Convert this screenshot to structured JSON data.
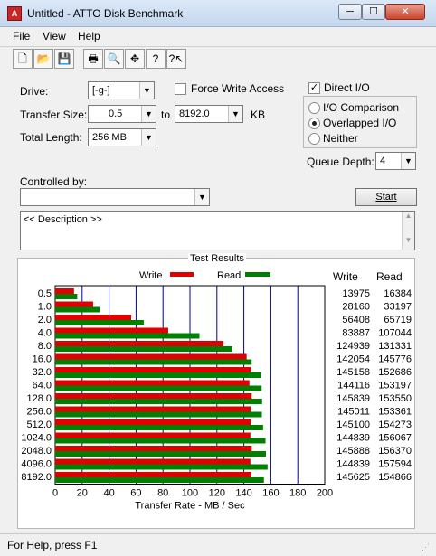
{
  "window": {
    "title": "Untitled - ATTO Disk Benchmark",
    "app_icon_label": "A",
    "controls": {
      "minimize": "─",
      "maximize": "☐",
      "close": "✕"
    }
  },
  "menu": [
    "File",
    "View",
    "Help"
  ],
  "toolbar": [
    "new-file-icon",
    "open-folder-icon",
    "save-icon",
    "print-icon",
    "print-preview-icon",
    "move-icon",
    "help-icon",
    "context-help-icon"
  ],
  "toolbar_glyphs": [
    "🗋",
    "📂",
    "💾",
    "🖶",
    "🔍",
    "✥",
    "?",
    "?↖"
  ],
  "form": {
    "drive_label": "Drive:",
    "drive_value": "[-g-]",
    "force_write_label": "Force Write Access",
    "direct_io_label": "Direct I/O",
    "direct_io_checked": true,
    "transfer_size_label": "Transfer Size:",
    "transfer_from": "0.5",
    "to_label": "to",
    "transfer_to": "8192.0",
    "kb_label": "KB",
    "total_length_label": "Total Length:",
    "total_length_value": "256 MB",
    "io_options": [
      "I/O Comparison",
      "Overlapped I/O",
      "Neither"
    ],
    "io_selected": 1,
    "queue_depth_label": "Queue Depth:",
    "queue_depth_value": "4",
    "controlled_by_label": "Controlled by:",
    "controlled_by_value": "",
    "start_label": "Start",
    "description": "<< Description >>"
  },
  "results": {
    "title": "Test Results",
    "write_header": "Write",
    "read_header": "Read",
    "write_color": "#e00000",
    "read_color": "#008000"
  },
  "chart_data": {
    "type": "bar",
    "orientation": "horizontal",
    "xlabel": "Transfer Rate - MB / Sec",
    "xlim": [
      0,
      200
    ],
    "xticks": [
      0,
      20,
      40,
      60,
      80,
      100,
      120,
      140,
      160,
      180,
      200
    ],
    "categories": [
      "0.5",
      "1.0",
      "2.0",
      "4.0",
      "8.0",
      "16.0",
      "32.0",
      "64.0",
      "128.0",
      "256.0",
      "512.0",
      "1024.0",
      "2048.0",
      "4096.0",
      "8192.0"
    ],
    "series": [
      {
        "name": "Write",
        "values": [
          13.975,
          28.16,
          56.408,
          83.887,
          124.939,
          142.054,
          145.158,
          144.116,
          145.839,
          145.011,
          145.1,
          144.839,
          145.888,
          144.839,
          145.625
        ]
      },
      {
        "name": "Read",
        "values": [
          16.384,
          33.197,
          65.719,
          107.044,
          131.331,
          145.776,
          152.686,
          153.197,
          153.55,
          153.361,
          154.273,
          156.067,
          156.37,
          157.594,
          154.866
        ]
      }
    ],
    "write_kb": [
      "13975",
      "28160",
      "56408",
      "83887",
      "124939",
      "142054",
      "145158",
      "144116",
      "145839",
      "145011",
      "145100",
      "144839",
      "145888",
      "144839",
      "145625"
    ],
    "read_kb": [
      "16384",
      "33197",
      "65719",
      "107044",
      "131331",
      "145776",
      "152686",
      "153197",
      "153550",
      "153361",
      "154273",
      "156067",
      "156370",
      "157594",
      "154866"
    ],
    "grid": true
  },
  "status": "For Help, press F1"
}
